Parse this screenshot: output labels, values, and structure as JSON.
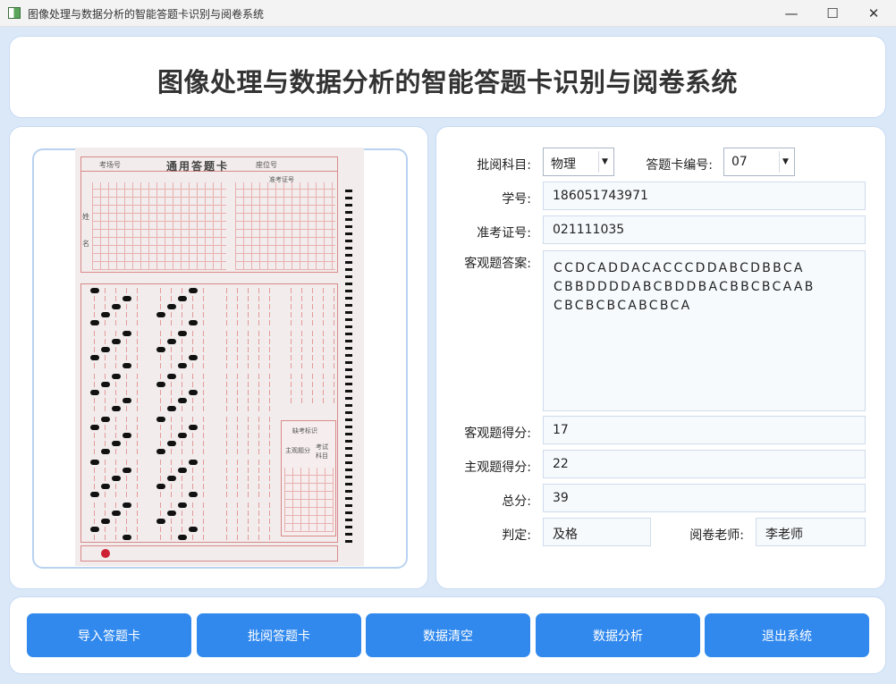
{
  "window": {
    "title": "图像处理与数据分析的智能答题卡识别与阅卷系统",
    "icon": "app-icon",
    "controls": {
      "minimize": "—",
      "maximize": "☐",
      "close": "✕"
    }
  },
  "header": {
    "title": "图像处理与数据分析的智能答题卡识别与阅卷系统"
  },
  "sheet_image": {
    "exam_room_label": "考场号",
    "title": "通用答题卡",
    "seat_label": "座位号",
    "ticket_label": "准考证号",
    "name_label": "姓名",
    "absent_label": "缺考标识",
    "subjective_label": "主观题分",
    "subject_label": "考试科目"
  },
  "form": {
    "subject_label": "批阅科目:",
    "subject_value": "物理",
    "card_no_label": "答题卡编号:",
    "card_no_value": "07",
    "student_id_label": "学号:",
    "student_id_value": "186051743971",
    "ticket_label": "准考证号:",
    "ticket_value": "021111035",
    "objective_answer_label": "客观题答案:",
    "objective_answer_lines": [
      "CCDCADDACACCCDDABCDBBCA",
      "CBBDDDDABCBDDBACBBCBCAAB",
      "CBCBCBCABCBCA"
    ],
    "objective_score_label": "客观题得分:",
    "objective_score_value": "17",
    "subjective_score_label": "主观题得分:",
    "subjective_score_value": "22",
    "total_label": "总分:",
    "total_value": "39",
    "judgement_label": "判定:",
    "judgement_value": "及格",
    "teacher_label": "阅卷老师:",
    "teacher_value": "李老师"
  },
  "buttons": {
    "import": "导入答题卡",
    "grade": "批阅答题卡",
    "clear": "数据清空",
    "analyze": "数据分析",
    "exit": "退出系统"
  },
  "colors": {
    "accent": "#3189ee",
    "background": "#dbe8f8",
    "panel_border": "#c7daf3"
  }
}
